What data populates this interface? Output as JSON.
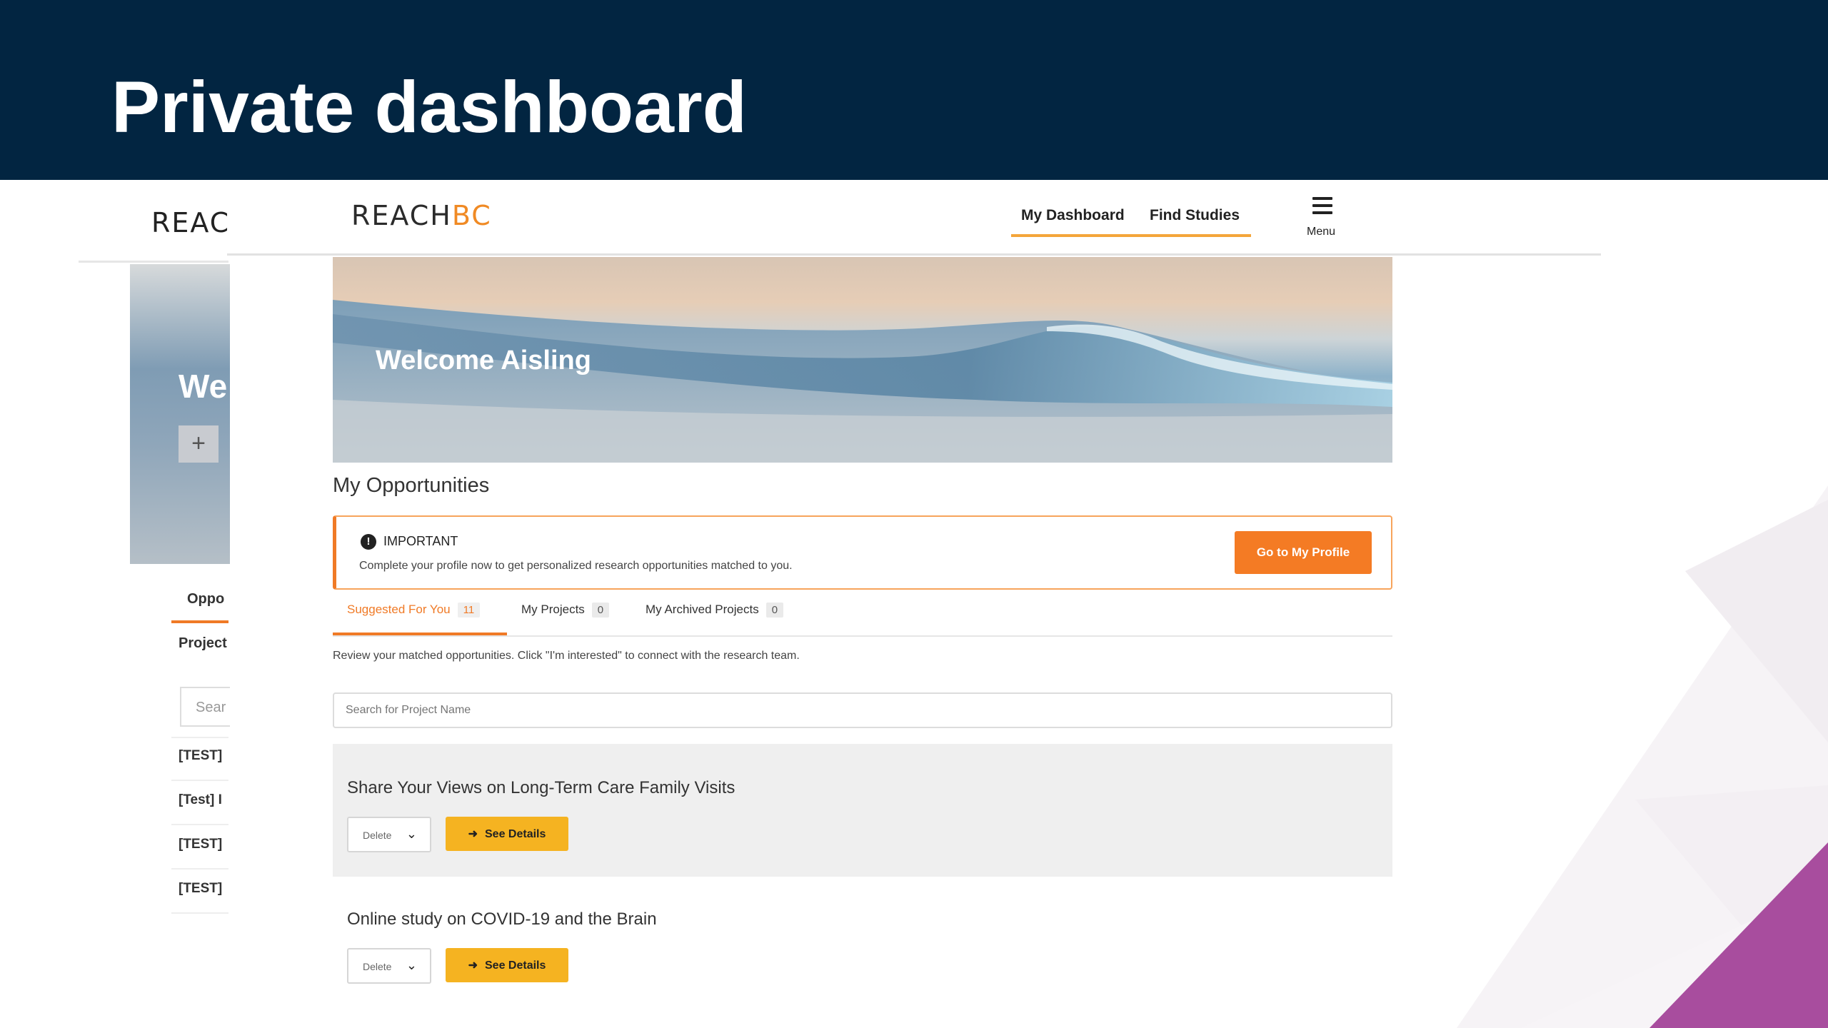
{
  "slide": {
    "title": "Private dashboard"
  },
  "background_screenshot": {
    "logo": "REACH",
    "welcome": "We",
    "plus": "+",
    "tab": "Oppo",
    "sub": "Project",
    "search_placeholder": "Sear",
    "rows": [
      "[TEST]",
      "[Test] I",
      "[TEST]",
      "[TEST]"
    ]
  },
  "site": {
    "logo_main": "REACH",
    "logo_accent": "BC",
    "nav": {
      "dashboard": "My Dashboard",
      "find": "Find Studies"
    },
    "menu_label": "Menu",
    "hero": {
      "welcome": "Welcome Aisling"
    },
    "section_title": "My Opportunities",
    "alert": {
      "title": "IMPORTANT",
      "text": "Complete your profile now to get personalized research opportunities matched to you.",
      "button": "Go to My Profile"
    },
    "tabs": [
      {
        "label": "Suggested For You",
        "count": "11"
      },
      {
        "label": "My Projects",
        "count": "0"
      },
      {
        "label": "My Archived Projects",
        "count": "0"
      }
    ],
    "info_text": "Review your matched opportunities. Click \"I'm interested\" to connect with the research team.",
    "search_placeholder": "Search for Project Name",
    "cards": [
      {
        "title": "Share Your Views on Long-Term Care Family Visits",
        "select": "Delete",
        "button": "See Details"
      },
      {
        "title": "Online study on COVID-19 and the Brain",
        "select": "Delete",
        "button": "See Details"
      }
    ]
  },
  "colors": {
    "header_bg": "#022541",
    "accent_orange": "#f47b24",
    "button_yellow": "#f5b321",
    "deco_purple": "#a84d9e"
  }
}
